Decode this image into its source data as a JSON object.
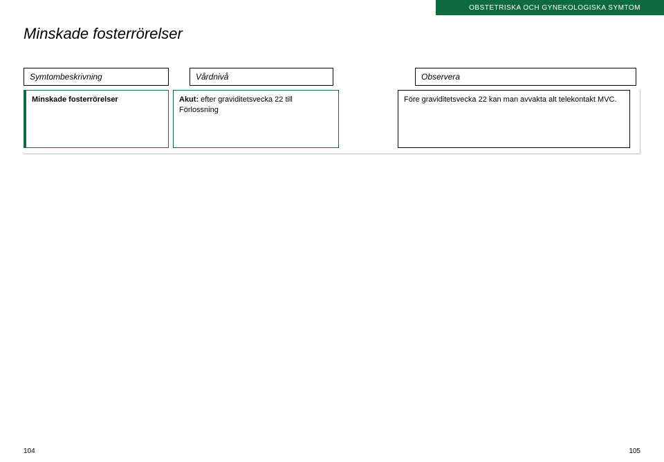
{
  "header": {
    "category": "OBSTETRISKA OCH GYNEKOLOGISKA SYMTOM"
  },
  "title": "Minskade fosterrörelser",
  "columns": {
    "c1": "Symtombeskrivning",
    "c2": "Vårdnivå",
    "c3": "Observera"
  },
  "row": {
    "symptom": "Minskade fosterrörelser",
    "care_bold": "Akut:",
    "care_rest": " efter graviditetsvecka 22 till Förlossning",
    "observe": "Före graviditetsvecka 22 kan man avvakta alt telekontakt MVC."
  },
  "page_left": "104",
  "page_right": "105"
}
